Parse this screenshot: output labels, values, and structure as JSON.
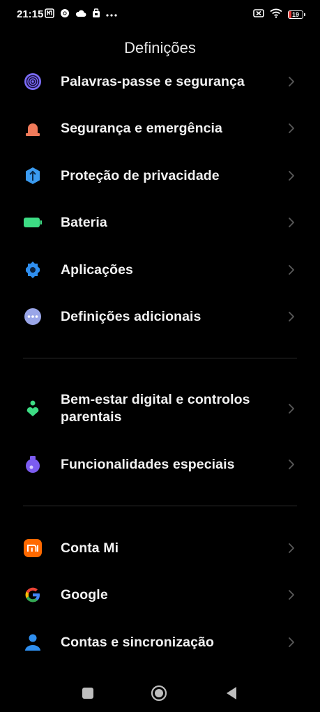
{
  "status_bar": {
    "time": "21:15",
    "battery_level": "19",
    "left_icons": [
      "nfc-icon",
      "chrome-icon",
      "cloud-icon",
      "lock-badge-icon",
      "more-dots-icon"
    ],
    "right_icons": [
      "sim-off-icon",
      "wifi-icon",
      "battery-icon"
    ],
    "battery_color": "#e53935"
  },
  "page": {
    "title": "Definições"
  },
  "groups": [
    {
      "items": [
        {
          "label": "Palavras-passe e segurança",
          "icon": "fingerprint-icon",
          "color": "#7b6cf6"
        },
        {
          "label": "Segurança e emergência",
          "icon": "emergency-light-icon",
          "color": "#f07a5a"
        },
        {
          "label": "Proteção de privacidade",
          "icon": "privacy-shield-icon",
          "color": "#3b9bf0"
        },
        {
          "label": "Bateria",
          "icon": "battery-icon",
          "color": "#3ddc84"
        },
        {
          "label": "Aplicações",
          "icon": "app-gear-icon",
          "color": "#2f8ff0"
        },
        {
          "label": "Definições adicionais",
          "icon": "more-settings-icon",
          "color": "#9aa6e8"
        }
      ]
    },
    {
      "items": [
        {
          "label": "Bem-estar digital e controlos parentais",
          "icon": "digital-wellbeing-icon",
          "color": "#3ddc84"
        },
        {
          "label": "Funcionalidades especiais",
          "icon": "special-features-icon",
          "color": "#7c5cf0"
        }
      ]
    },
    {
      "items": [
        {
          "label": "Conta Mi",
          "icon": "mi-logo-icon",
          "color": "#ff6900"
        },
        {
          "label": "Google",
          "icon": "google-logo-icon",
          "color": "#4285f4"
        },
        {
          "label": "Contas e sincronização",
          "icon": "account-icon",
          "color": "#2f8ff0"
        }
      ]
    }
  ],
  "nav_bar": {
    "buttons": [
      "recent-apps-icon",
      "home-icon",
      "back-icon"
    ]
  }
}
